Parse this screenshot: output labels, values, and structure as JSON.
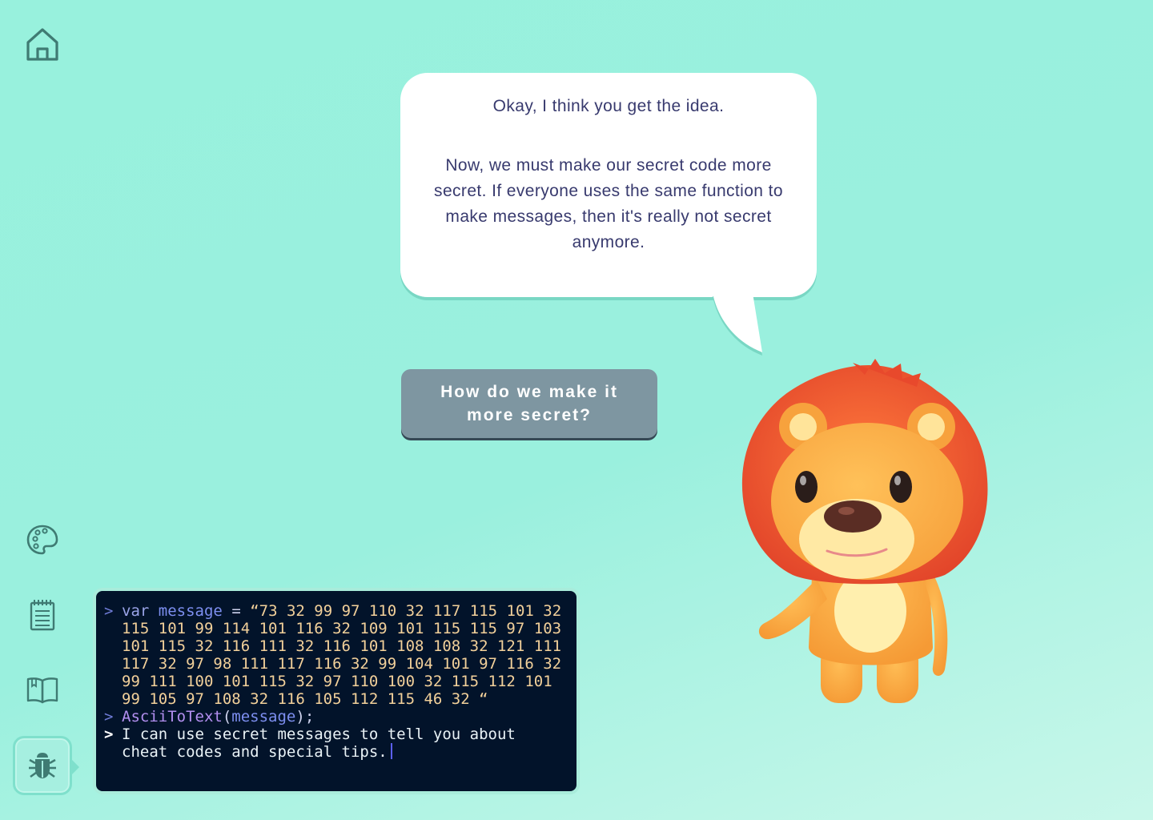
{
  "icons": {
    "home": "home-icon",
    "palette": "palette-icon",
    "notepad": "notepad-icon",
    "book": "book-icon",
    "bug": "bug-icon"
  },
  "colors": {
    "background": "#98f1dd",
    "bubble": "#ffffff",
    "bubble_text": "#383a6e",
    "choice_button": "#7e96a1",
    "console_bg": "#02132a",
    "number_color": "#f2d09a"
  },
  "dialog": {
    "line1": "Okay, I think you get the idea.",
    "line2": "Now, we must make our secret code more secret. If everyone uses the same function to make messages, then it's really not secret anymore."
  },
  "choice": {
    "label": "How do we make it more secret?"
  },
  "console": {
    "prompt_in": ">",
    "prompt_out": ">",
    "line1_keyword": "var",
    "line1_variable": "message",
    "line1_operator": "=",
    "line1_value": "“73 32 99 97 110 32 117 115 101 32 115 101 99 114 101 116 32 109 101 115 115 97 103 101 115 32 116 111 32 116 101 108 108 32 121 111 117 32 97 98 111 117 116 32 99 104 101 97 116 32 99 111 100 101 115 32 97 110 100 32 115 112 101 99 105 97 108 32 116 105 112 115 46 32 “",
    "line2_function": "AsciiToText",
    "line2_open": "(",
    "line2_arg": "message",
    "line2_close": ");",
    "output": "I can use secret messages to tell you about cheat codes and special tips."
  }
}
